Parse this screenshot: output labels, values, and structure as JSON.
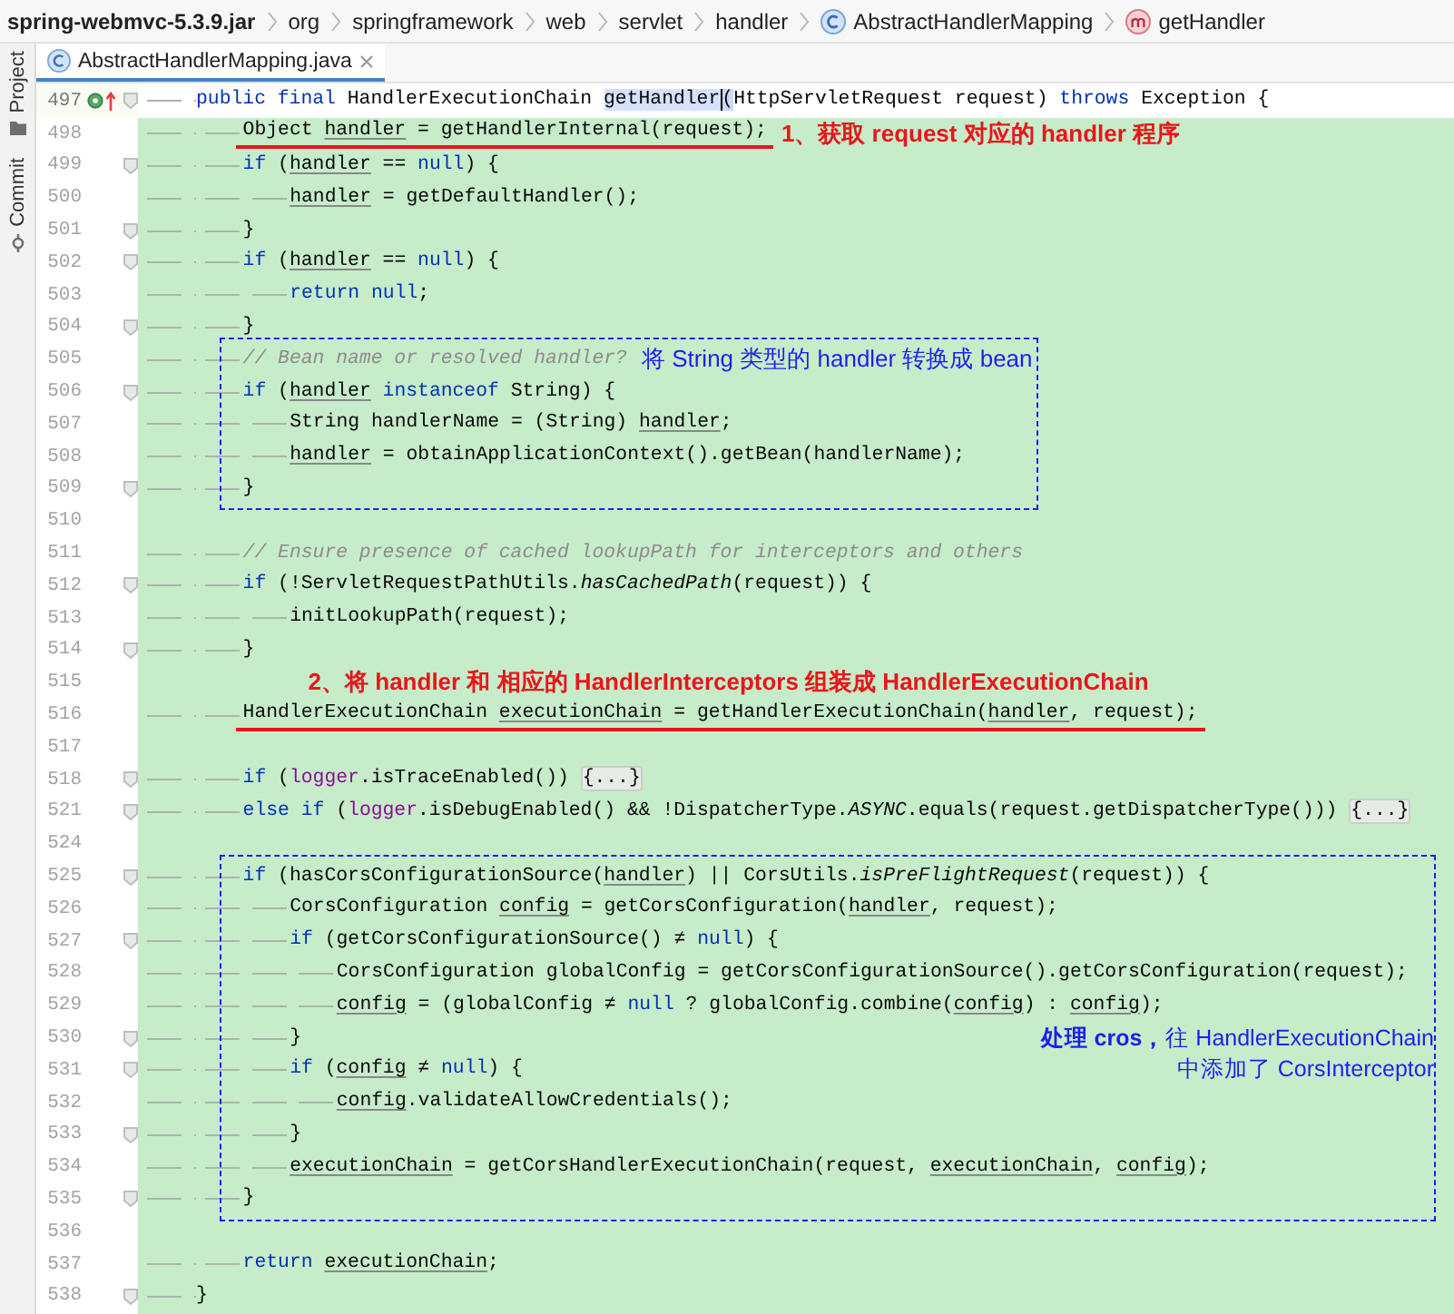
{
  "breadcrumbs": [
    {
      "label": "spring-webmvc-5.3.9.jar",
      "kind": "jar"
    },
    {
      "label": "org",
      "kind": "package"
    },
    {
      "label": "springframework",
      "kind": "package"
    },
    {
      "label": "web",
      "kind": "package"
    },
    {
      "label": "servlet",
      "kind": "package"
    },
    {
      "label": "handler",
      "kind": "package"
    },
    {
      "label": "AbstractHandlerMapping",
      "kind": "class"
    },
    {
      "label": "getHandler",
      "kind": "method"
    }
  ],
  "side_tools": [
    {
      "label": "Project",
      "kind": "folder"
    },
    {
      "label": "Commit",
      "kind": "commit"
    }
  ],
  "tabs": [
    {
      "label": "AbstractHandlerMapping.java",
      "selected": true
    }
  ],
  "editor": {
    "rows": [
      {
        "kind": "line",
        "number": "497",
        "highlighted": false,
        "marked": true,
        "fold": true,
        "tokens": [
          {
            "kind": "kw",
            "text": "public final "
          },
          {
            "kind": "plain",
            "text": "HandlerExecutionChain "
          },
          {
            "kind": "hl",
            "text": "getHandler"
          },
          {
            "kind": "match",
            "text": "("
          },
          {
            "kind": "plain",
            "text": "HttpServletRequest request) "
          },
          {
            "kind": "kw",
            "text": "throws "
          },
          {
            "kind": "plain",
            "text": "Exception {"
          }
        ],
        "children": [
          {
            "kind": "line",
            "number": "498",
            "highlighted": true,
            "marked": false,
            "fold": false,
            "underline": true,
            "note": {
              "kind": "step",
              "text": "1、获取 request 对应的 handler 程序"
            },
            "tokens": [
              {
                "kind": "plain",
                "text": "Object "
              },
              {
                "kind": "var",
                "text": "handler"
              },
              {
                "kind": "plain",
                "text": " = getHandlerInternal(request);"
              }
            ]
          },
          {
            "kind": "line",
            "number": "499",
            "highlighted": true,
            "marked": false,
            "fold": true,
            "tokens": [
              {
                "kind": "kw",
                "text": "if "
              },
              {
                "kind": "plain",
                "text": "("
              },
              {
                "kind": "var",
                "text": "handler"
              },
              {
                "kind": "plain",
                "text": " == "
              },
              {
                "kind": "kw",
                "text": "null"
              },
              {
                "kind": "plain",
                "text": ") {"
              }
            ],
            "children": [
              {
                "kind": "line",
                "number": "500",
                "highlighted": true,
                "marked": false,
                "fold": false,
                "tokens": [
                  {
                    "kind": "var",
                    "text": "handler"
                  },
                  {
                    "kind": "plain",
                    "text": " = getDefaultHandler();"
                  }
                ]
              }
            ]
          },
          {
            "kind": "line",
            "number": "501",
            "highlighted": true,
            "marked": false,
            "fold": true,
            "tokens": [
              {
                "kind": "plain",
                "text": "}"
              }
            ]
          },
          {
            "kind": "line",
            "number": "502",
            "highlighted": true,
            "marked": false,
            "fold": true,
            "tokens": [
              {
                "kind": "kw",
                "text": "if "
              },
              {
                "kind": "plain",
                "text": "("
              },
              {
                "kind": "var",
                "text": "handler"
              },
              {
                "kind": "plain",
                "text": " == "
              },
              {
                "kind": "kw",
                "text": "null"
              },
              {
                "kind": "plain",
                "text": ") {"
              }
            ],
            "children": [
              {
                "kind": "line",
                "number": "503",
                "highlighted": true,
                "marked": false,
                "fold": false,
                "tokens": [
                  {
                    "kind": "kw",
                    "text": "return null"
                  },
                  {
                    "kind": "plain",
                    "text": ";"
                  }
                ]
              }
            ]
          },
          {
            "kind": "line",
            "number": "504",
            "highlighted": true,
            "marked": false,
            "fold": true,
            "tokens": [
              {
                "kind": "plain",
                "text": "}"
              }
            ]
          },
          {
            "kind": "box",
            "children": [
              {
                "kind": "line",
                "number": "505",
                "highlighted": true,
                "marked": false,
                "fold": false,
                "note": {
                  "kind": "remark",
                  "text": "将 String 类型的 handler 转换成 bean"
                },
                "tokens": [
                  {
                    "kind": "comment",
                    "text": "// Bean name or resolved handler?"
                  }
                ]
              },
              {
                "kind": "line",
                "number": "506",
                "highlighted": true,
                "marked": false,
                "fold": true,
                "tokens": [
                  {
                    "kind": "kw",
                    "text": "if "
                  },
                  {
                    "kind": "plain",
                    "text": "("
                  },
                  {
                    "kind": "var",
                    "text": "handler"
                  },
                  {
                    "kind": "kw",
                    "text": " instanceof "
                  },
                  {
                    "kind": "plain",
                    "text": "String) {"
                  }
                ],
                "children": [
                  {
                    "kind": "line",
                    "number": "507",
                    "highlighted": true,
                    "marked": false,
                    "fold": false,
                    "tokens": [
                      {
                        "kind": "plain",
                        "text": "String handlerName = (String) "
                      },
                      {
                        "kind": "var",
                        "text": "handler"
                      },
                      {
                        "kind": "plain",
                        "text": ";"
                      }
                    ]
                  },
                  {
                    "kind": "line",
                    "number": "508",
                    "highlighted": true,
                    "marked": false,
                    "fold": false,
                    "tokens": [
                      {
                        "kind": "var",
                        "text": "handler"
                      },
                      {
                        "kind": "plain",
                        "text": " = obtainApplicationContext().getBean(handlerName);"
                      }
                    ]
                  }
                ]
              },
              {
                "kind": "line",
                "number": "509",
                "highlighted": true,
                "marked": false,
                "fold": true,
                "tokens": [
                  {
                    "kind": "plain",
                    "text": "}"
                  }
                ]
              }
            ]
          },
          {
            "kind": "line",
            "number": "510",
            "highlighted": true,
            "marked": false,
            "fold": false
          },
          {
            "kind": "line",
            "number": "511",
            "highlighted": true,
            "marked": false,
            "fold": false,
            "tokens": [
              {
                "kind": "comment",
                "text": "// Ensure presence of cached lookupPath for interceptors and others"
              }
            ]
          },
          {
            "kind": "line",
            "number": "512",
            "highlighted": true,
            "marked": false,
            "fold": true,
            "tokens": [
              {
                "kind": "kw",
                "text": "if "
              },
              {
                "kind": "plain",
                "text": "(!ServletRequestPathUtils."
              },
              {
                "kind": "static",
                "text": "hasCachedPath"
              },
              {
                "kind": "plain",
                "text": "(request)) {"
              }
            ],
            "children": [
              {
                "kind": "line",
                "number": "513",
                "highlighted": true,
                "marked": false,
                "fold": false,
                "tokens": [
                  {
                    "kind": "plain",
                    "text": "initLookupPath(request);"
                  }
                ]
              }
            ]
          },
          {
            "kind": "line",
            "number": "514",
            "highlighted": true,
            "marked": false,
            "fold": true,
            "tokens": [
              {
                "kind": "plain",
                "text": "}"
              }
            ]
          },
          {
            "kind": "line",
            "number": "515",
            "highlighted": true,
            "marked": false,
            "fold": false,
            "note": {
              "kind": "step",
              "text": "2、将 handler 和 相应的 HandlerInterceptors 组装成 HandlerExecutionChain"
            }
          },
          {
            "kind": "line",
            "number": "516",
            "highlighted": true,
            "marked": false,
            "fold": false,
            "underline": true,
            "tokens": [
              {
                "kind": "plain",
                "text": "HandlerExecutionChain "
              },
              {
                "kind": "var",
                "text": "executionChain"
              },
              {
                "kind": "plain",
                "text": " = getHandlerExecutionChain("
              },
              {
                "kind": "var",
                "text": "handler"
              },
              {
                "kind": "plain",
                "text": ", request);"
              }
            ]
          },
          {
            "kind": "line",
            "number": "517",
            "highlighted": true,
            "marked": false,
            "fold": false
          },
          {
            "kind": "line",
            "number": "518",
            "highlighted": true,
            "marked": false,
            "fold": true,
            "tokens": [
              {
                "kind": "kw",
                "text": "if "
              },
              {
                "kind": "plain",
                "text": "("
              },
              {
                "kind": "field",
                "text": "logger"
              },
              {
                "kind": "plain",
                "text": ".isTraceEnabled()) "
              },
              {
                "kind": "folded",
                "text": "{...}"
              }
            ]
          },
          {
            "kind": "line",
            "number": "521",
            "highlighted": true,
            "marked": false,
            "fold": true,
            "tokens": [
              {
                "kind": "kw",
                "text": "else if "
              },
              {
                "kind": "plain",
                "text": "("
              },
              {
                "kind": "field",
                "text": "logger"
              },
              {
                "kind": "plain",
                "text": ".isDebugEnabled() && !DispatcherType."
              },
              {
                "kind": "static",
                "text": "ASYNC"
              },
              {
                "kind": "plain",
                "text": ".equals(request.getDispatcherType())) "
              },
              {
                "kind": "folded",
                "text": "{...}"
              }
            ]
          },
          {
            "kind": "line",
            "number": "524",
            "highlighted": true,
            "marked": false,
            "fold": false
          },
          {
            "kind": "box",
            "note_lines": [
              "**处理 cros，**往 HandlerExecutionChain",
              "中添加了 CorsInterceptor"
            ],
            "children": [
              {
                "kind": "line",
                "number": "525",
                "highlighted": true,
                "marked": false,
                "fold": true,
                "tokens": [
                  {
                    "kind": "kw",
                    "text": "if "
                  },
                  {
                    "kind": "plain",
                    "text": "(hasCorsConfigurationSource("
                  },
                  {
                    "kind": "var",
                    "text": "handler"
                  },
                  {
                    "kind": "plain",
                    "text": ") || CorsUtils."
                  },
                  {
                    "kind": "static",
                    "text": "isPreFlightRequest"
                  },
                  {
                    "kind": "plain",
                    "text": "(request)) {"
                  }
                ],
                "children": [
                  {
                    "kind": "line",
                    "number": "526",
                    "highlighted": true,
                    "marked": false,
                    "fold": false,
                    "tokens": [
                      {
                        "kind": "plain",
                        "text": "CorsConfiguration "
                      },
                      {
                        "kind": "var",
                        "text": "config"
                      },
                      {
                        "kind": "plain",
                        "text": " = getCorsConfiguration("
                      },
                      {
                        "kind": "var",
                        "text": "handler"
                      },
                      {
                        "kind": "plain",
                        "text": ", request);"
                      }
                    ]
                  },
                  {
                    "kind": "line",
                    "number": "527",
                    "highlighted": true,
                    "marked": false,
                    "fold": true,
                    "tokens": [
                      {
                        "kind": "kw",
                        "text": "if "
                      },
                      {
                        "kind": "plain",
                        "text": "(getCorsConfigurationSource() ≠ "
                      },
                      {
                        "kind": "kw",
                        "text": "null"
                      },
                      {
                        "kind": "plain",
                        "text": ") {"
                      }
                    ],
                    "children": [
                      {
                        "kind": "line",
                        "number": "528",
                        "highlighted": true,
                        "marked": false,
                        "fold": false,
                        "tokens": [
                          {
                            "kind": "plain",
                            "text": "CorsConfiguration globalConfig = getCorsConfigurationSource().getCorsConfiguration(request);"
                          }
                        ]
                      },
                      {
                        "kind": "line",
                        "number": "529",
                        "highlighted": true,
                        "marked": false,
                        "fold": false,
                        "tokens": [
                          {
                            "kind": "var",
                            "text": "config"
                          },
                          {
                            "kind": "plain",
                            "text": " = (globalConfig ≠ "
                          },
                          {
                            "kind": "kw",
                            "text": "null"
                          },
                          {
                            "kind": "plain",
                            "text": " ? globalConfig.combine("
                          },
                          {
                            "kind": "var",
                            "text": "config"
                          },
                          {
                            "kind": "plain",
                            "text": ") : "
                          },
                          {
                            "kind": "var",
                            "text": "config"
                          },
                          {
                            "kind": "plain",
                            "text": ");"
                          }
                        ]
                      }
                    ]
                  },
                  {
                    "kind": "line",
                    "number": "530",
                    "highlighted": true,
                    "marked": false,
                    "fold": true,
                    "tokens": [
                      {
                        "kind": "plain",
                        "text": "}"
                      }
                    ]
                  },
                  {
                    "kind": "line",
                    "number": "531",
                    "highlighted": true,
                    "marked": false,
                    "fold": true,
                    "tokens": [
                      {
                        "kind": "kw",
                        "text": "if "
                      },
                      {
                        "kind": "plain",
                        "text": "("
                      },
                      {
                        "kind": "var",
                        "text": "config"
                      },
                      {
                        "kind": "plain",
                        "text": " ≠ "
                      },
                      {
                        "kind": "kw",
                        "text": "null"
                      },
                      {
                        "kind": "plain",
                        "text": ") {"
                      }
                    ],
                    "children": [
                      {
                        "kind": "line",
                        "number": "532",
                        "highlighted": true,
                        "marked": false,
                        "fold": false,
                        "tokens": [
                          {
                            "kind": "var",
                            "text": "config"
                          },
                          {
                            "kind": "plain",
                            "text": ".validateAllowCredentials();"
                          }
                        ]
                      }
                    ]
                  },
                  {
                    "kind": "line",
                    "number": "533",
                    "highlighted": true,
                    "marked": false,
                    "fold": true,
                    "tokens": [
                      {
                        "kind": "plain",
                        "text": "}"
                      }
                    ]
                  },
                  {
                    "kind": "line",
                    "number": "534",
                    "highlighted": true,
                    "marked": false,
                    "fold": false,
                    "tokens": [
                      {
                        "kind": "var",
                        "text": "executionChain"
                      },
                      {
                        "kind": "plain",
                        "text": " = getCorsHandlerExecutionChain(request, "
                      },
                      {
                        "kind": "var",
                        "text": "executionChain"
                      },
                      {
                        "kind": "plain",
                        "text": ", "
                      },
                      {
                        "kind": "var",
                        "text": "config"
                      },
                      {
                        "kind": "plain",
                        "text": ");"
                      }
                    ]
                  }
                ]
              },
              {
                "kind": "line",
                "number": "535",
                "highlighted": true,
                "marked": false,
                "fold": true,
                "tokens": [
                  {
                    "kind": "plain",
                    "text": "}"
                  }
                ]
              }
            ]
          },
          {
            "kind": "line",
            "number": "536",
            "highlighted": true,
            "marked": false,
            "fold": false
          },
          {
            "kind": "line",
            "number": "537",
            "highlighted": true,
            "marked": false,
            "fold": false,
            "tokens": [
              {
                "kind": "kw",
                "text": "return "
              },
              {
                "kind": "var",
                "text": "executionChain"
              },
              {
                "kind": "plain",
                "text": ";"
              }
            ]
          }
        ]
      },
      {
        "kind": "line",
        "number": "538",
        "highlighted": true,
        "marked": false,
        "fold": true,
        "tokens": [
          {
            "kind": "plain",
            "text": "}"
          }
        ]
      }
    ]
  }
}
